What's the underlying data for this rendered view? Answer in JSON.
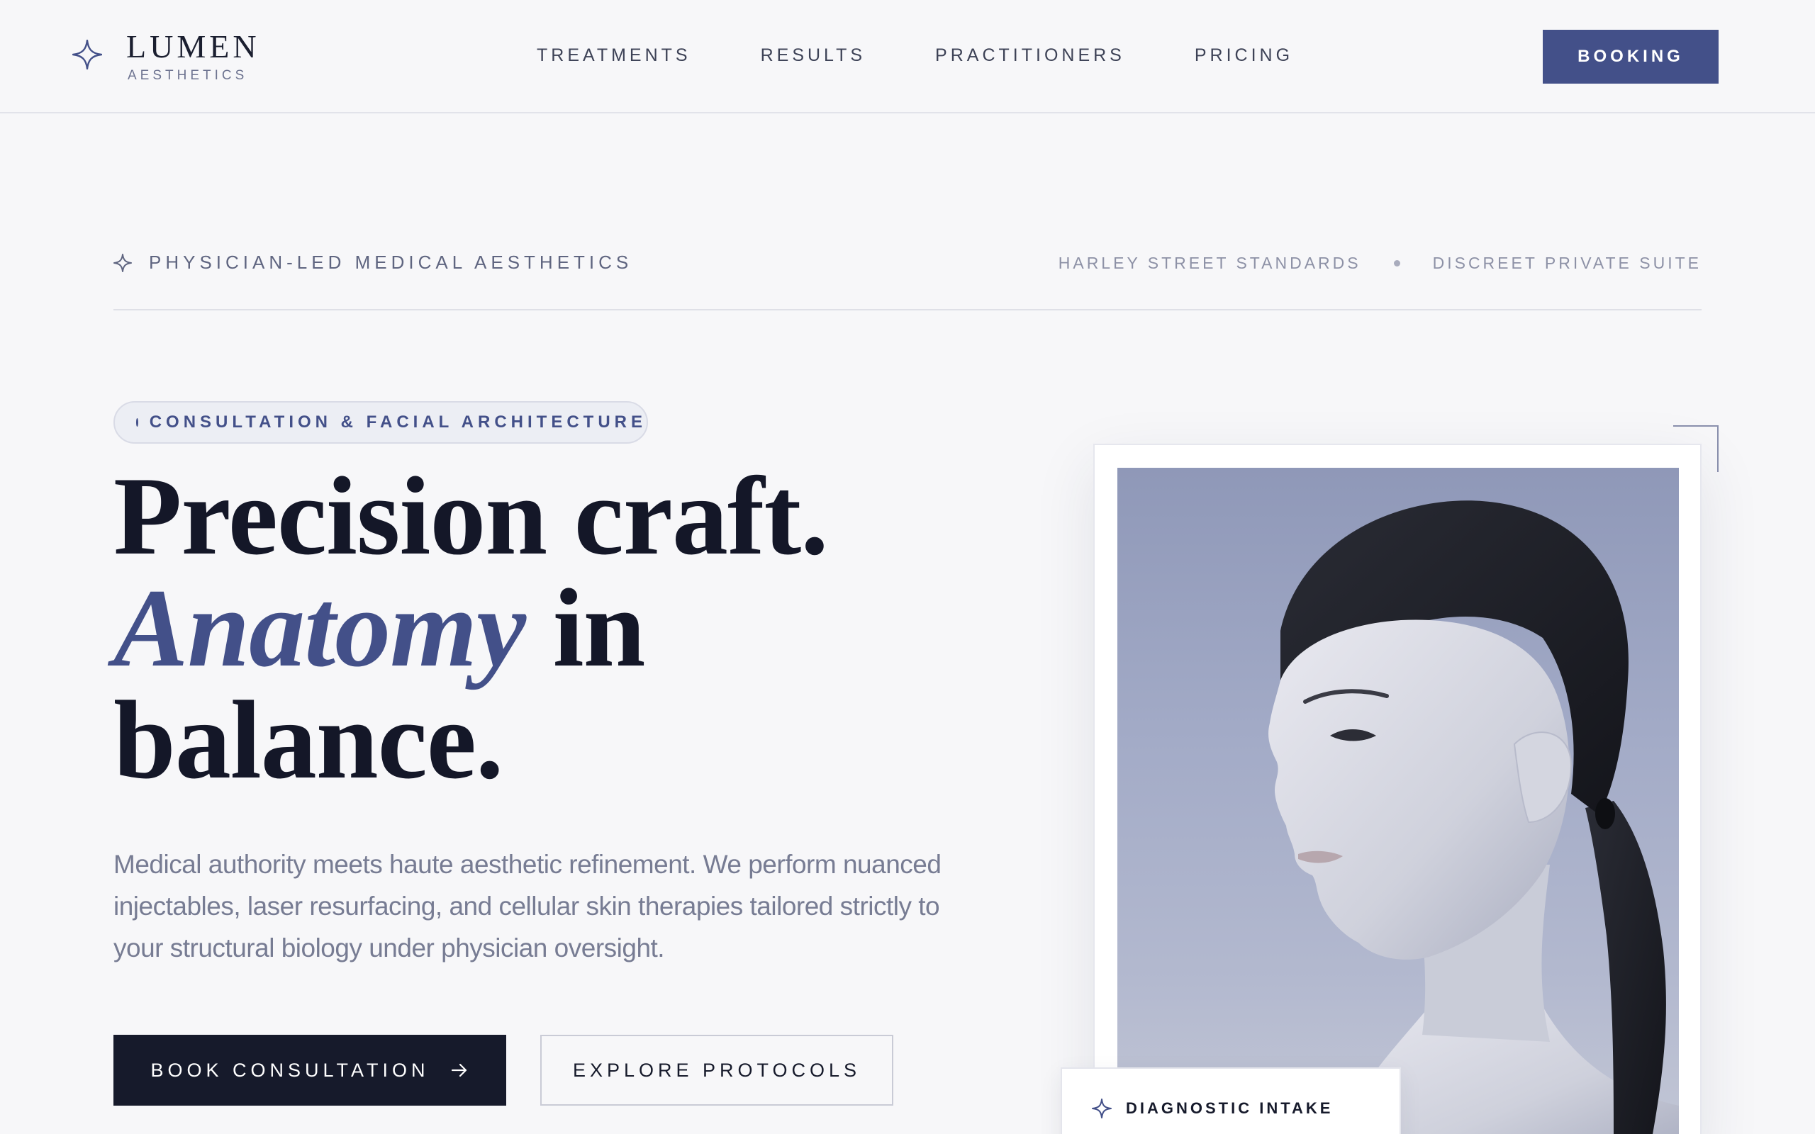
{
  "brand": {
    "name": "LUMEN",
    "sub": "AESTHETICS",
    "icon": "sparkle-icon"
  },
  "nav": {
    "items": [
      {
        "label": "TREATMENTS"
      },
      {
        "label": "RESULTS"
      },
      {
        "label": "PRACTITIONERS"
      },
      {
        "label": "PRICING"
      }
    ],
    "booking_label": "BOOKING"
  },
  "meta": {
    "tagline": "PHYSICIAN-LED MEDICAL AESTHETICS",
    "right": [
      "HARLEY STREET STANDARDS",
      "DISCREET PRIVATE SUITE"
    ]
  },
  "hero": {
    "pill": "CONSULTATION & FACIAL ARCHITECTURE",
    "headline": {
      "line1": "Precision craft.",
      "accent": "Anatomy",
      "line2_rest": " in",
      "line3": "balance."
    },
    "lede": "Medical authority meets haute aesthetic refinement. We perform nuanced injectables, laser resurfacing, and cellular skin therapies tailored strictly to your structural biology under physician oversight.",
    "primary_cta": "BOOK CONSULTATION",
    "secondary_cta": "EXPLORE PROTOCOLS"
  },
  "card": {
    "intake_label": "DIAGNOSTIC INTAKE"
  },
  "colors": {
    "accent": "#435089",
    "ink": "#161a2b",
    "background": "#f7f7f9",
    "muted": "#777c93"
  }
}
